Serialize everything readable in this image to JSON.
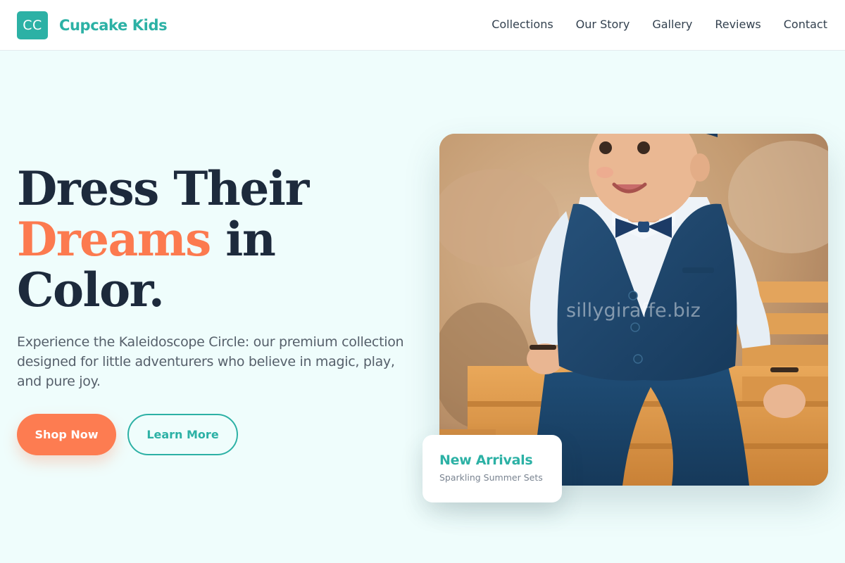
{
  "brand": {
    "logo_text": "CC",
    "name": "Cupcake Kids",
    "color": "#2cb1a5"
  },
  "nav": {
    "links": [
      "Collections",
      "Our Story",
      "Gallery",
      "Reviews",
      "Contact"
    ]
  },
  "hero": {
    "title_line1": "Dress Their",
    "title_accent": "Dreams",
    "title_in": " in",
    "title_line3": "Color.",
    "description": "Experience the Kaleidoscope Circle: our premium collection designed for little adventurers who believe in magic, play, and pure joy.",
    "primary_button": "Shop Now",
    "secondary_button": "Learn More",
    "accent_color": "#fc7a4f"
  },
  "image": {
    "subject": "toddler boy in navy waistcoat, bow tie and trousers sitting on a wooden crate",
    "watermark": "sillygiraffe.biz"
  },
  "card": {
    "title": "New Arrivals",
    "subtitle": "Sparkling Summer Sets"
  }
}
